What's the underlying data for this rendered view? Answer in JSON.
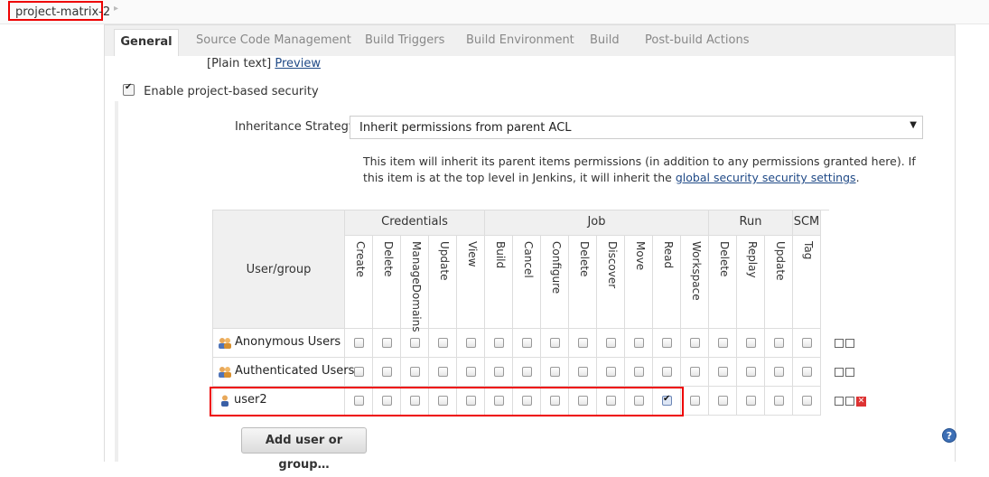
{
  "breadcrumb": {
    "project": "project-matrix-2",
    "arrow": "▸"
  },
  "tabs": [
    "General",
    "Source Code Management",
    "Build Triggers",
    "Build Environment",
    "Build",
    "Post-build Actions"
  ],
  "description_links": {
    "plain_text": "[Plain text]",
    "preview": "Preview"
  },
  "security": {
    "enable_label": "Enable project-based security",
    "enabled": true,
    "inheritance_label": "Inheritance Strategy",
    "inheritance_value": "Inherit permissions from parent ACL",
    "help_text": "This item will inherit its parent items permissions (in addition to any permissions granted here). If this item is at the top level in Jenkins, it will inherit the ",
    "help_link": "global security security settings",
    "help_end": "."
  },
  "matrix": {
    "user_group_header": "User/group",
    "groups": [
      "Credentials",
      "Job",
      "Run",
      "SCM"
    ],
    "permissions": [
      "Create",
      "Delete",
      "ManageDomains",
      "Update",
      "View",
      "Build",
      "Cancel",
      "Configure",
      "Delete",
      "Discover",
      "Move",
      "Read",
      "Workspace",
      "Delete",
      "Replay",
      "Update",
      "Tag"
    ],
    "rows": [
      {
        "name": "Anonymous Users",
        "checked": []
      },
      {
        "name": "Authenticated Users",
        "checked": []
      },
      {
        "name": "user2",
        "checked": [
          11
        ]
      }
    ]
  },
  "add_button": "Add user or group…",
  "help_icon": "?"
}
